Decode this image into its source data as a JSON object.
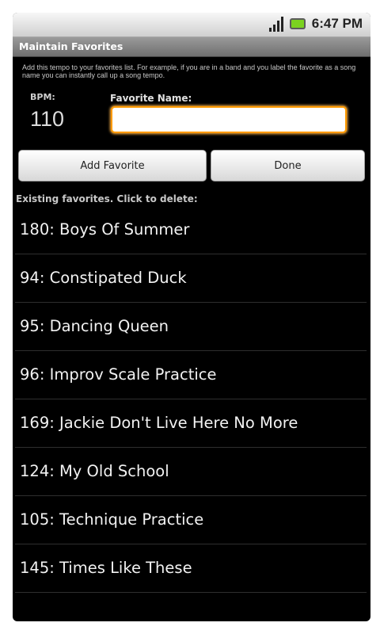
{
  "status_bar": {
    "time": "6:47 PM",
    "signal_icon": "signal-icon",
    "battery_icon": "battery-icon",
    "battery_color": "#7bd21f"
  },
  "title_bar": {
    "title": "Maintain Favorites"
  },
  "form": {
    "description": "Add this tempo to your favorites list. For example, if you are in a band and you label the favorite as a song name you can instantly call up a song tempo.",
    "bpm_label": "BPM:",
    "bpm_value": "110",
    "favorite_name_label": "Favorite Name:",
    "favorite_name_value": "",
    "favorite_name_placeholder": "",
    "focus_color": "#ff9a00"
  },
  "buttons": {
    "add_label": "Add Favorite",
    "done_label": "Done"
  },
  "favorites": {
    "header": "Existing favorites. Click to delete:",
    "items": [
      "180: Boys Of Summer",
      "94: Constipated Duck",
      "95: Dancing Queen",
      "96: Improv Scale Practice",
      "169: Jackie Don't Live Here No More",
      "124: My Old School",
      "105: Technique Practice",
      "145: Times Like These"
    ]
  }
}
